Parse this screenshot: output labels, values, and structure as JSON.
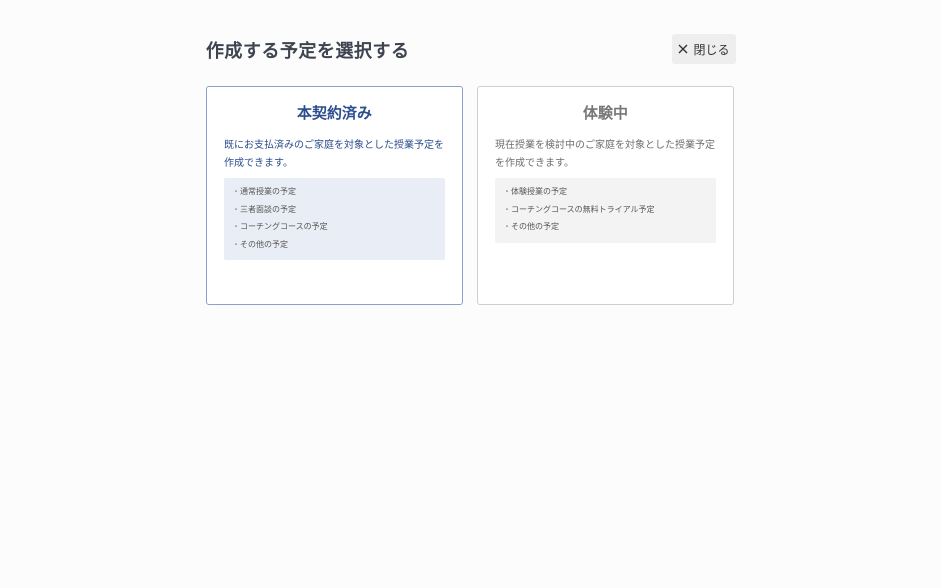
{
  "header": {
    "title": "作成する予定を選択する",
    "close_label": "閉じる"
  },
  "cards": [
    {
      "title": "本契約済み",
      "description": "既にお支払済みのご家庭を対象とした授業予定を作成できます。",
      "items": [
        "通常授業の予定",
        "三者面談の予定",
        "コーチングコースの予定",
        "その他の予定"
      ]
    },
    {
      "title": "体験中",
      "description": "現在授業を検討中のご家庭を対象とした授業予定を作成できます。",
      "items": [
        "体験授業の予定",
        "コーチングコースの無料トライアル予定",
        "その他の予定"
      ]
    }
  ],
  "icons": {
    "close": "close-icon"
  },
  "colors": {
    "accent": "#2b4d8e",
    "contracted_border": "#8aa2c8",
    "contracted_list_bg": "#e9edf5",
    "trial_list_bg": "#f3f3f3"
  }
}
